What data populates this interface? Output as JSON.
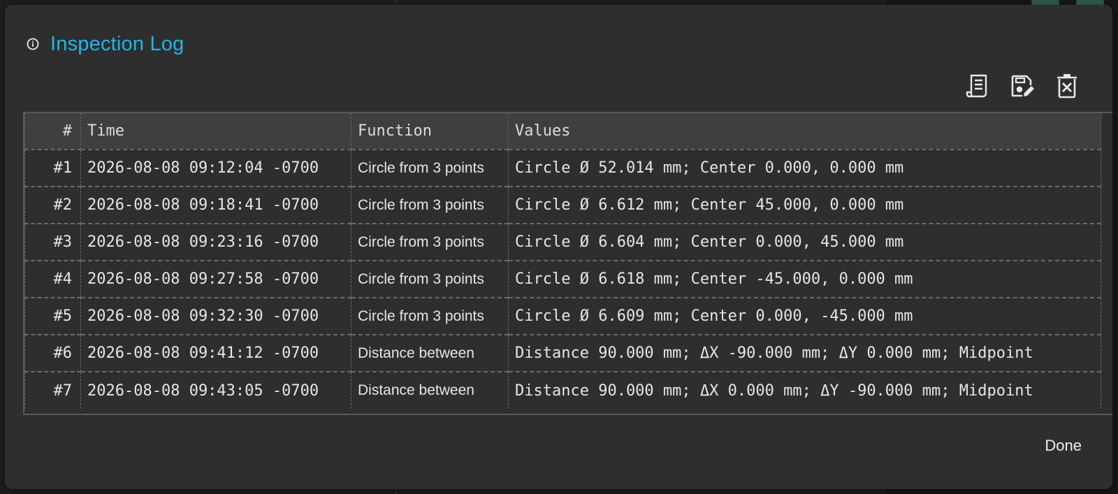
{
  "dialog": {
    "title": "Inspection Log",
    "title_color": "#1fb7e6",
    "icons": {
      "title": "info-icon",
      "toolbar": [
        "receipt-icon",
        "save-edit-icon",
        "clear-trash-icon"
      ]
    },
    "done_label": "Done"
  },
  "table": {
    "columns": [
      "#",
      "Time",
      "Function",
      "Values"
    ],
    "rows": [
      {
        "num": "#1",
        "time": "2026-08-08 09:12:04 -0700",
        "function": "Circle from 3 points",
        "values": "Circle Ø 52.014 mm; Center 0.000, 0.000 mm"
      },
      {
        "num": "#2",
        "time": "2026-08-08 09:18:41 -0700",
        "function": "Circle from 3 points",
        "values": "Circle Ø 6.612 mm; Center 45.000, 0.000 mm"
      },
      {
        "num": "#3",
        "time": "2026-08-08 09:23:16 -0700",
        "function": "Circle from 3 points",
        "values": "Circle Ø 6.604 mm; Center 0.000, 45.000 mm"
      },
      {
        "num": "#4",
        "time": "2026-08-08 09:27:58 -0700",
        "function": "Circle from 3 points",
        "values": "Circle Ø 6.618 mm; Center -45.000, 0.000 mm"
      },
      {
        "num": "#5",
        "time": "2026-08-08 09:32:30 -0700",
        "function": "Circle from 3 points",
        "values": "Circle Ø 6.609 mm; Center 0.000, -45.000 mm"
      },
      {
        "num": "#6",
        "time": "2026-08-08 09:41:12 -0700",
        "function": "Distance between",
        "values": "Distance 90.000 mm; ΔX -90.000 mm; ΔY 0.000 mm; Midpoint"
      },
      {
        "num": "#7",
        "time": "2026-08-08 09:43:05 -0700",
        "function": "Distance between",
        "values": "Distance 90.000 mm; ΔX 0.000 mm; ΔY -90.000 mm; Midpoint"
      }
    ]
  }
}
